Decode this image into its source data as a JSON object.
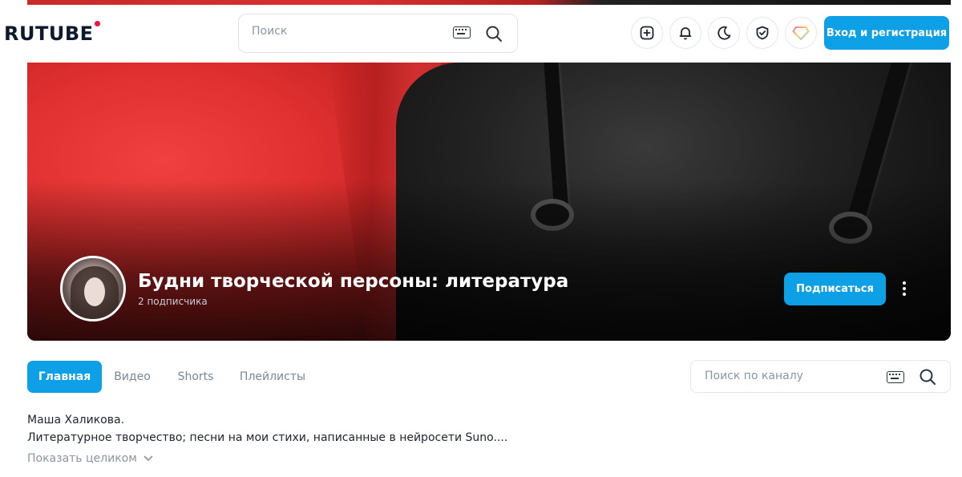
{
  "header": {
    "logo_text": "RUTUBE",
    "search_placeholder": "Поиск",
    "login_label": "Вход и регистрация",
    "icons": [
      "add-video-icon",
      "bell-icon",
      "moon-icon",
      "shield-icon",
      "diamond-icon"
    ]
  },
  "channel": {
    "title": "Будни творческой персоны: литература",
    "subscribers": "2 подписчика",
    "subscribe_label": "Подписаться"
  },
  "tabs": [
    {
      "label": "Главная",
      "active": true
    },
    {
      "label": "Видео",
      "active": false
    },
    {
      "label": "Shorts",
      "active": false
    },
    {
      "label": "Плейлисты",
      "active": false
    }
  ],
  "channel_search": {
    "placeholder": "Поиск по каналу"
  },
  "description": {
    "line1": "Маша Халикова.",
    "line2": "Литературное творчество; песни на мои стихи, написанные в нейросети Suno....",
    "show_more_label": "Показать целиком"
  },
  "colors": {
    "accent": "#0ea0e6",
    "logo_dot": "#ed143d"
  }
}
